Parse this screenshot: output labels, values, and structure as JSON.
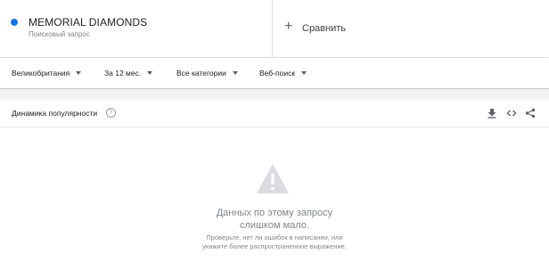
{
  "term": {
    "title": "MEMORIAL DIAMONDS",
    "subtitle": "Поисковый запрос",
    "color": "#1a73e8"
  },
  "compare": {
    "label": "Сравнить",
    "icon": "plus-icon"
  },
  "filters": {
    "region": "Великобритания",
    "period": "За 12 мес.",
    "category": "Все категории",
    "search_type": "Веб-поиск"
  },
  "card": {
    "title": "Динамика популярности",
    "help_icon": "help-circle-icon",
    "actions": [
      "download-icon",
      "embed-code-icon",
      "share-icon"
    ]
  },
  "empty_state": {
    "icon": "warning-icon",
    "main_line1": "Данных по этому запросу",
    "main_line2": "слишком мало.",
    "sub_line1": "Проверьте, нет ли ошибок в написании, или",
    "sub_line2": "укажите более распространенное выражение."
  }
}
